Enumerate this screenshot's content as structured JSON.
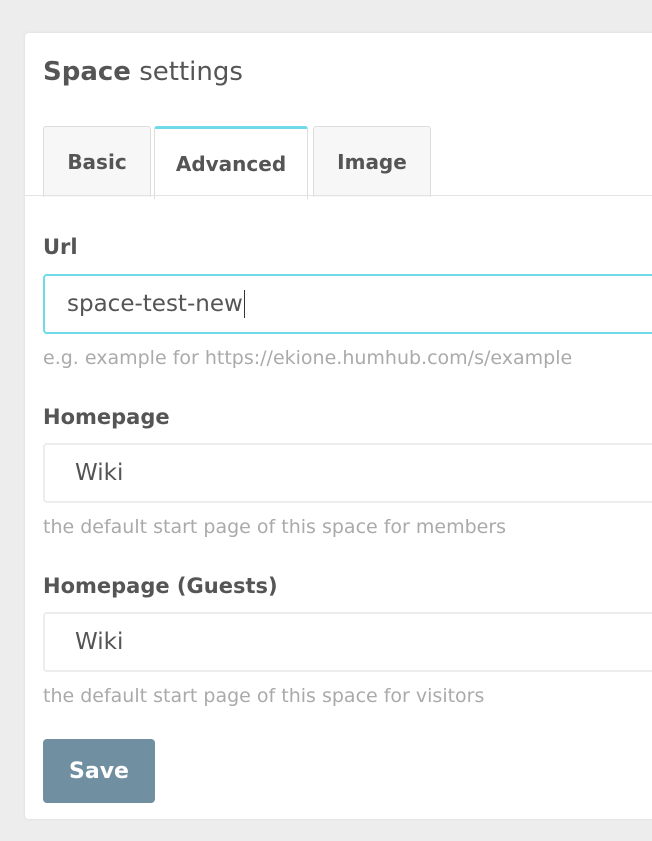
{
  "panel": {
    "title_strong": "Space",
    "title_light": "settings"
  },
  "tabs": [
    {
      "label": "Basic",
      "active": false
    },
    {
      "label": "Advanced",
      "active": true
    },
    {
      "label": "Image",
      "active": false
    }
  ],
  "form": {
    "url": {
      "label": "Url",
      "value": "space-test-new",
      "help": "e.g. example for https://ekione.humhub.com/s/example"
    },
    "homepage": {
      "label": "Homepage",
      "value": "Wiki",
      "help": "the default start page of this space for members"
    },
    "homepage_guests": {
      "label": "Homepage (Guests)",
      "value": "Wiki",
      "help": "the default start page of this space for visitors"
    }
  },
  "save_button": {
    "label": "Save"
  },
  "colors": {
    "accent": "#6fdbe8",
    "save": "#708fa0",
    "background": "#ededed"
  }
}
